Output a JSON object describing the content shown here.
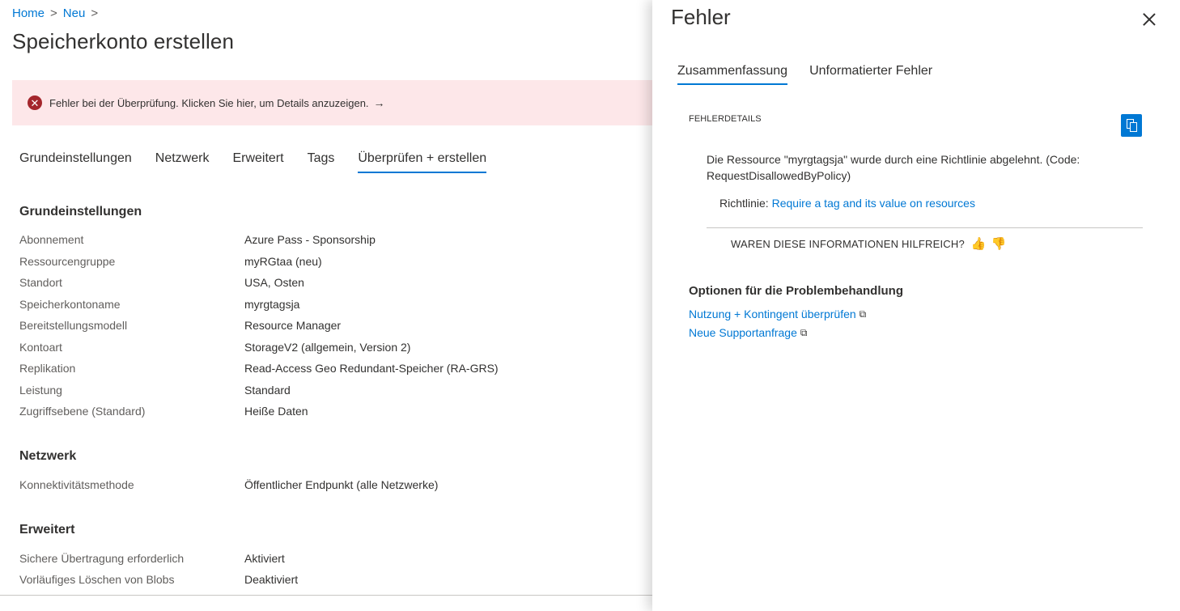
{
  "breadcrumb": {
    "home": "Home",
    "neu": "Neu",
    "sep": ">"
  },
  "page_title": "Speicherkonto erstellen",
  "banner": {
    "icon": "error-circle-icon",
    "text": "Fehler bei der Überprüfung. Klicken Sie hier, um Details anzuzeigen.",
    "arrow": "→"
  },
  "tabs": [
    "Grundeinstellungen",
    "Netzwerk",
    "Erweitert",
    "Tags",
    "Überprüfen + erstellen"
  ],
  "sections": {
    "grund": {
      "title": "Grundeinstellungen",
      "rows": [
        {
          "k": "Abonnement",
          "v": "Azure Pass - Sponsorship"
        },
        {
          "k": "Ressourcengruppe",
          "v": "myRGtaa (neu)"
        },
        {
          "k": "Standort",
          "v": "USA, Osten"
        },
        {
          "k": "Speicherkontoname",
          "v": "myrgtagsja"
        },
        {
          "k": "Bereitstellungsmodell",
          "v": "Resource Manager"
        },
        {
          "k": "Kontoart",
          "v": "StorageV2 (allgemein, Version 2)"
        },
        {
          "k": "Replikation",
          "v": "Read-Access Geo Redundant-Speicher (RA-GRS)"
        },
        {
          "k": "Leistung",
          "v": "Standard"
        },
        {
          "k": "Zugriffsebene (Standard)",
          "v": "Heiße Daten"
        }
      ]
    },
    "netzwerk": {
      "title": "Netzwerk",
      "rows": [
        {
          "k": "Konnektivitätsmethode",
          "v": "Öffentlicher Endpunkt (alle Netzwerke)"
        }
      ]
    },
    "erweitert": {
      "title": "Erweitert",
      "rows": [
        {
          "k": "Sichere Übertragung erforderlich",
          "v": "Aktiviert"
        },
        {
          "k": "Vorläufiges Löschen von Blobs",
          "v": "Deaktiviert"
        }
      ]
    }
  },
  "panel": {
    "title": "Fehler",
    "tabs": [
      "Zusammenfassung",
      "Unformatierter Fehler"
    ],
    "details_label": "FEHLERDETAILS",
    "error_message": "Die Ressource \"myrgtagsja\" wurde durch eine Richtlinie abgelehnt. (Code: RequestDisallowedByPolicy)",
    "policy_prefix": "Richtlinie:",
    "policy_link": "Require a tag and its value on resources",
    "feedback_question": "WAREN DIESE INFORMATIONEN HILFREICH?",
    "options_title": "Optionen für die Problembehandlung",
    "links": [
      "Nutzung + Kontingent überprüfen",
      "Neue Supportanfrage"
    ]
  },
  "colors": {
    "accent": "#0078d4",
    "error": "#a4262c",
    "error_bg": "#fde7e9"
  }
}
